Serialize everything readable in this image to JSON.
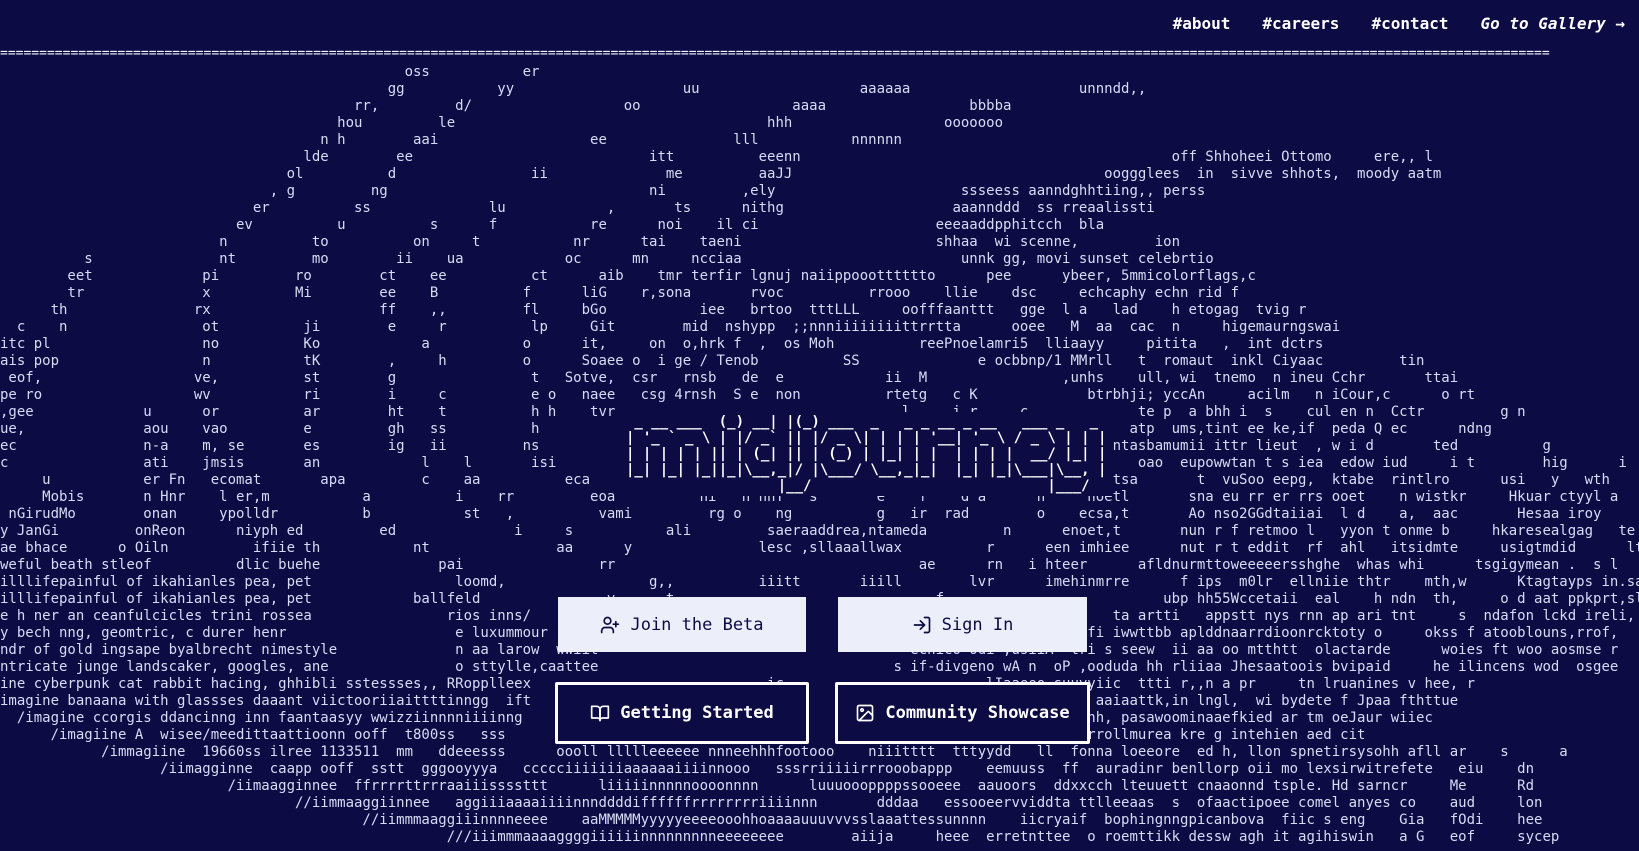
{
  "nav": {
    "about": "#about",
    "careers": "#careers",
    "contact": "#contact",
    "gallery": "Go to Gallery →"
  },
  "rule": "======================================================================================================================================================================================================",
  "art_lines": [
    "                                                oss           er",
    "                                              gg           yy                    uu                   aaaaaa                    unnndd,,",
    "                                          rr,         d/                  oo                  aaaa                 bbbba",
    "                                        hou         le                                     hhh                  ooooooo",
    "                                      n h        aai                  ee               lll           nnnnnn",
    "                                    lde        ee                            itt          eeenn                                            off Shhoheei Ottomo     ere,, l",
    "                                  ol          d                ii              me         aaJJ                                     ooggglees  in  sivve shhots,  moody aatm",
    "                                , g         ng                               ni         ,ely                      ssseess aanndghhtiing,, perss",
    "                              er          ss              lu            ,       ts      nithg                    aaannddd  ss rreaalissti",
    "                            ev          u          s      f           re      noi    il ci                     eeeaaddpphitcch  bla",
    "                          n          to          on     t           nr      tai    taeni                       shhaa  wi scenne,         ion",
    "          s               nt         mo        ii    ua            oc      mn     ncciaa                          unnk gg, movi sunset celebrtio",
    "        eet             pi         ro        ct    ee          ct      aib    tmr terfir lgnuj naiippoootttttto      pee      ybeer, 5mmicolorflags,c",
    "        tr              x          Mi        ee    B          f      liG    r,sona       rvoc          rrooo    llie    dsc     echcaphy echn rid f",
    "      th               rx                    ff    ,,         fl     bGo           iee   brtoo  tttLLL     oofffaanttt   gge  l a   lad    h etogag  tvig r",
    "  c    n                ot          ji        e     r          lp     Git        mid  nshypp  ;;nnniiiiiiiittrrtta      ooee   M  aa  cac  n     higemaurngswai",
    "itc pl                  no          Ko            a           o      it,     on  o,hrk f  ,  os Moh          reePnoelamri5  lliaayy     pitita   ,  int dctrs",
    "ais pop                 n           tK        ,     h         o      Soaee o  i ge / Tenob          SS              e ocbbnp/1 MMrll   t  romaut  inkl Ciyaac         tin",
    " eof,                  ve,          st        g                t   Sotve,  csr   rnsb   de  e            ii  M                ,unhs    ull, wi  tnemo  n ineu Cchr       ttai",
    "pe ro                  wv           ri        i     c          e o   naee   csg 4rnsh  S e  non          rtetg   c K             btrbhji; yccAn     acilm   n iCour,c      o rt",
    ",gee             u      or          ar        ht    t          h h    tvr                                  l     i r     c             te p  a bhh i  s    cul en n  Cctr         g n",
    "ue,              aou    vao         e         gh   ss          h                                                                      atp  ums,tint ee ke,if  peda Q ec      ndng",
    "ec               n-a    m, se       es        ig   ii         ns                                                                    ntasbamumii ittr lieut  , w i d       ted          g",
    "c                ati    jmsis       an            l    l       isi                                                                     oao  eupowwtan t s iea  edow iud     i t        hig      i",
    "     u           er Fn   ecomat       apa         c    aa          eca       gc   eu,                     e     ser                 tsa       t  vuSoo eepg,  ktabe  rintlro      usi   y   wth      ou",
    "     Mobis       n Hnr    l er,m           a          i    rr         eoa          ni   n nhT   s       e    f    d a      n     noetl       sna eu rr er rrs ooet    n wistkr     Hkuar ctyyl a    l a",
    " nGirudMo        onan     ypolldr          b           st   ,          vami         rg o    ng          g   ir  rad        o    ecsa,t       Ao nso2GGdtaiiai  l d    a,  aac       Hesaa iroy     suty",
    "y JanGi         onReon      niyph ed         ed              i     s           ali         saeraaddrea,ntameda         n      enoet,t       nun r f retmoo l   yyon t onme b     hkaresealgag   te s",
    "ae bhace      o Oiln          ifiie th           nt               aa      y               lesc ,sllaaallwax          r      een imhiee      nut r t eddit  rf  ahl   itsidmte     usigtmdid      ltt",
    "weful beath stleof          dlic buehe              pai                rr                                    ae      rn   i hteer      afldnurmttoweeeeersshghe  whas whi      tsgigymean .  s l",
    "illlifepainful of ikahianles pea, pet                 loomd,                 g,,          iiitt       iiill        lvr      imehinmrre      f ips  m0lr  ellniie thtr    mth,w      Ktagtayps in.saric",
    "illlifepainful of ikahianles pea, pet            ballfeld               v      t                               f                          ubp hh55Wccetaii  eal    h ndn  th,     o d aat ppkprt,slstce",
    "e h ner an ceanfulcicles trini rossea                rios inns/                 eni                                                 ta artti   appstt nys rnn ap ari tnt     s  ndafon lckd ireli,",
    "y bech nng, geomtric, c durer henr                    e luxummour                                                                fi iwwttbb aplddnaarrdioonrcktoty o     okss f atooblouns,rrof,",
    "ndr of gold ingsape byalbrecht nimestyle              n aa larow  wwiit                                     ecnico odi ,usiiA  tri s seew  ii aa oo mtthtt  olactarde      woies ft woo aosmse r",
    "ntricate junge landscaker, googles, ane               o sttylle,caattee                                   s if-divgeno wA n  oP ,ooduda hh rliiaa Jhesaatoois bvipaid     he ilincens wod  osgee",
    "ine cyberpunk cat rabbit hacing, ghhibli sstessses,, RRopplleex                            ic                        lIaaeeo suuyyiic  ttti r,,n a pr     tn lruanines v hee, r",
    "imagine banaana with glassses daaant viictooriiaittttinngg  ift                           eb                        ggohheekk     aaiaattk,in lngl,  wi bydete f Jpaa fthttue",
    "  /imagine ccorgis ddancinng inn faantaasyy wwizziinnnniiiinng                            mmu                       ii   sswwstrrhh, pasawoominaaefkied ar tm oeJaur wiiec",
    "      /imagiine A  wisee/meedittaattioonn ooff  t800ss   sss                                                   ,,rrrroogonnrremmrrrollmurea kre g intehien aed cit",
    "            /immagiine  19660ss ilree 1133511  mm   ddeeesss      oooll llllleeeeee nnneehhhfootooo    niiitttt  tttyydd   ll  fonna loeeore  ed h, llon spnetirsysohh afll ar    s      a",
    "                   /iimagginne  caapp ooff  sstt  gggooyyya   ccccciiiiiiiaaaaaaiiiinnooo   sssrriiiiirrrooobappp    eemuuss  ff  auradinr benllorp oii mo lexsirwitrefete   eiu    dn",
    "                           /iimaagginnee  ffrrrrttrrraaiiissssttt      liiiiinnnnnoooonnnn      luuuoooppppssooeee  aauoors  ddxxcch lteuuett cnaaonnd tsple. Hd sarncr     Me      Rd",
    "                                   //iimmaaggiinnee   aggiiiaaaaiiiinnnddddiffffffrrrrrrrriiiinnn       dddaa   essooeervviddta ttlleeaas  s  ofaactipoee comel anyes co    aud     lon",
    "                                           //iimmmaaggiiinnnneeee    aaMMMMMyyyyyeeeeooohhoaaaauuuvvvsslaaattessunnnn    iicryaif  bophingnngpicanbova  fiic s eng    Gia   fOdi    hee",
    "                                                     ///iiimmmaaaaggggiiiiiinnnnnnnnneeeeeeee        aiija     heee  erretnttee  o roemttikk dessw agh it agihiswin   a G   eof     sycep"
  ],
  "logo": " _ __ ___  (_) __| |(_) ___  _   _ _ __ _ __   ___ _   _\n| '_ ` _ \\ | |/ _` || |/ _ \\| | | | '__| '_ \\ / _ \\ | | |\n| | | | | || | (_| || | (_) | |_| | |  | | | |  __/ |_| |\n|_| |_| |_||_|\\__,_|/ |\\___/ \\__,_|_|  |_| |_|\\___|\\__, |\n                  |__/                            |___/",
  "buttons": {
    "join_beta": "Join the Beta",
    "sign_in": "Sign In",
    "getting_started": "Getting Started",
    "community_showcase": "Community Showcase"
  },
  "icons": {
    "join_beta": "user-plus-icon",
    "sign_in": "sign-in-icon",
    "getting_started": "book-open-icon",
    "community_showcase": "image-icon"
  },
  "colors": {
    "background": "#0d0b44",
    "text": "#d7d9f2",
    "light_button": "#eceef9"
  }
}
